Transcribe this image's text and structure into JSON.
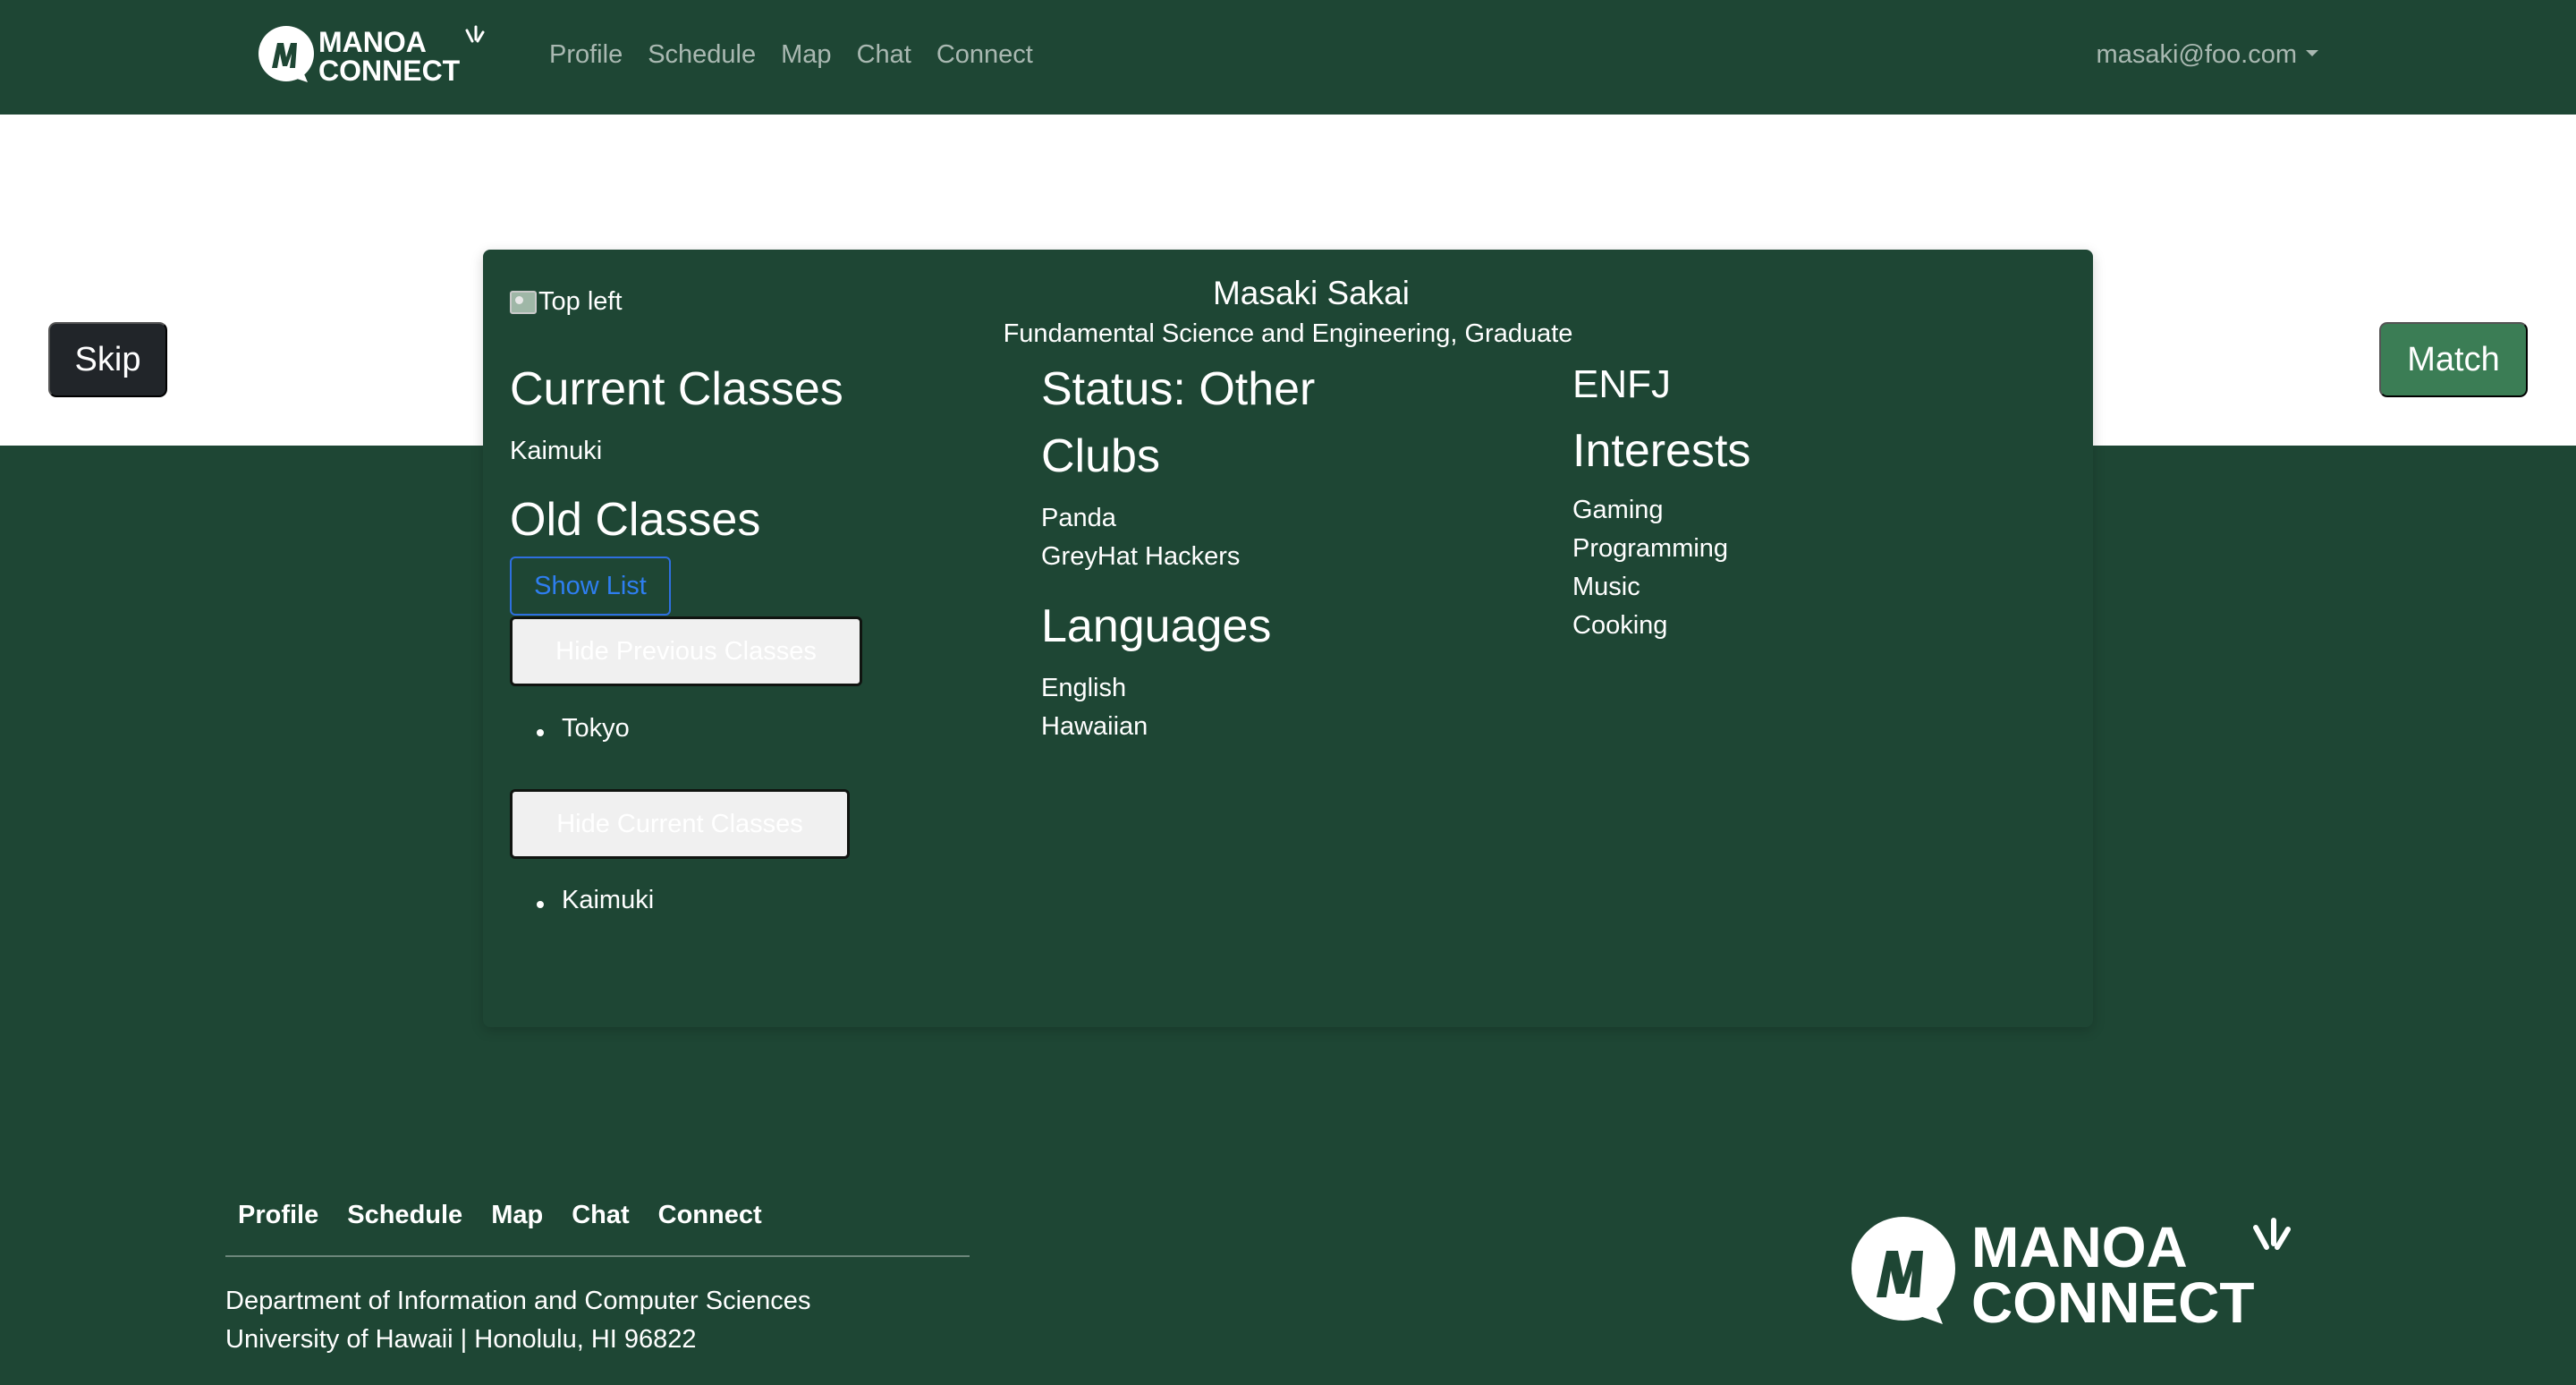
{
  "brand": {
    "line1": "MANOA",
    "line2": "CONNECT",
    "logo_icon": "manoa-m-bubble-icon"
  },
  "nav": {
    "links": [
      "Profile",
      "Schedule",
      "Map",
      "Chat",
      "Connect"
    ],
    "user": "masaki@foo.com"
  },
  "actions": {
    "skip": "Skip",
    "match": "Match"
  },
  "card": {
    "image_alt": "Top left",
    "name": "Masaki Sakai",
    "subtitle": "Fundamental Science and Engineering, Graduate",
    "current_classes": {
      "heading": "Current Classes",
      "items": [
        "Kaimuki"
      ]
    },
    "old_classes": {
      "heading": "Old Classes",
      "show_list_button": "Show List",
      "hide_previous_button": "Hide Previous Classes",
      "previous_items": [
        "Tokyo"
      ],
      "hide_current_button": "Hide Current Classes",
      "current_items": [
        "Kaimuki"
      ]
    },
    "status": "Status: Other",
    "clubs": {
      "heading": "Clubs",
      "items": [
        "Panda",
        "GreyHat Hackers"
      ]
    },
    "languages": {
      "heading": "Languages",
      "items": [
        "English",
        "Hawaiian"
      ]
    },
    "personality": "ENFJ",
    "interests": {
      "heading": "Interests",
      "items": [
        "Gaming",
        "Programming",
        "Music",
        "Cooking"
      ]
    }
  },
  "footer": {
    "links": [
      "Profile",
      "Schedule",
      "Map",
      "Chat",
      "Connect"
    ],
    "line1": "Department of Information and Computer Sciences",
    "line2": "University of Hawaii | Honolulu, HI 96822"
  },
  "colors": {
    "primary_green": "#1e4634",
    "match_green": "#3b7d55",
    "skip_dark": "#212529",
    "outline_blue": "#2e7ef0"
  }
}
